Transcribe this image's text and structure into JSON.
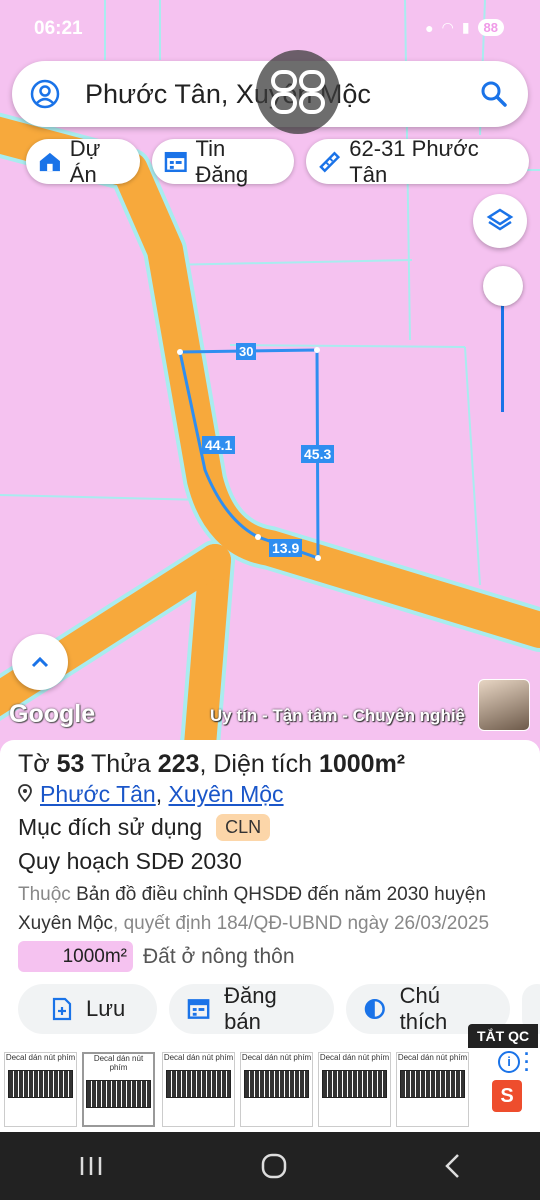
{
  "status": {
    "time": "06:21",
    "badge": "88"
  },
  "search": {
    "query": "Phước Tân, Xuyên Mộc"
  },
  "chips": [
    {
      "label": "Dự Án",
      "icon": "house-icon"
    },
    {
      "label": "Tin Đăng",
      "icon": "calendar-icon"
    },
    {
      "label": "62-31 Phước Tân",
      "icon": "ruler-icon"
    }
  ],
  "map": {
    "edges": {
      "top": "30",
      "left": "44.1",
      "right": "45.3",
      "bottom": "13.9"
    },
    "google": "Google",
    "slogan": "Uy tín - Tận tâm - Chuyên nghiệ"
  },
  "parcel": {
    "sheet_label": "Tờ",
    "sheet": "53",
    "parcel_label": "Thửa",
    "parcel_no": "223",
    "area_label": ", Diện tích",
    "area": "1000m²",
    "ward": "Phước Tân",
    "district": "Xuyên Mộc",
    "purpose_label": "Mục đích sử dụng",
    "purpose_code": "CLN",
    "plan_title": "Quy hoạch SDĐ 2030",
    "belongs_prefix": "Thuộc",
    "plan_name": "Bản đồ điều chỉnh QHSDĐ đến năm 2030 huyện Xuyên Mộc",
    "decision": ", quyết định 184/QĐ-UBND ngày 26/03/2025",
    "zone_area": "1000m²",
    "zone_type": "Đất ở nông thôn"
  },
  "actions": [
    {
      "label": "Lưu",
      "icon": "save-add-icon"
    },
    {
      "label": "Đăng bán",
      "icon": "listing-icon"
    },
    {
      "label": "Chú thích",
      "icon": "legend-icon"
    }
  ],
  "ad": {
    "close_label": "TẮT QC",
    "thumb_title": "Decal dán nút phím",
    "colors": {
      "accent": "#1a73e8",
      "road": "#f7a93c",
      "land": "#f5c2f0",
      "parcel": "#2f8ef0"
    }
  }
}
